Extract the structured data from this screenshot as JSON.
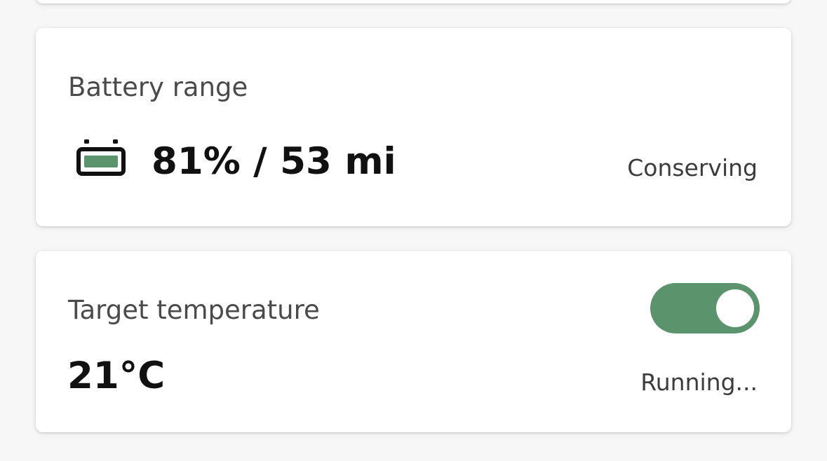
{
  "battery": {
    "title": "Battery range",
    "value": "81% / 53 mi",
    "status": "Conserving",
    "icon": "battery-icon"
  },
  "temperature": {
    "title": "Target temperature",
    "value": "21°C",
    "status": "Running...",
    "toggle_on": true
  },
  "colors": {
    "accent": "#5a936c",
    "card_background": "#ffffff",
    "page_background": "#f7f7f7"
  }
}
